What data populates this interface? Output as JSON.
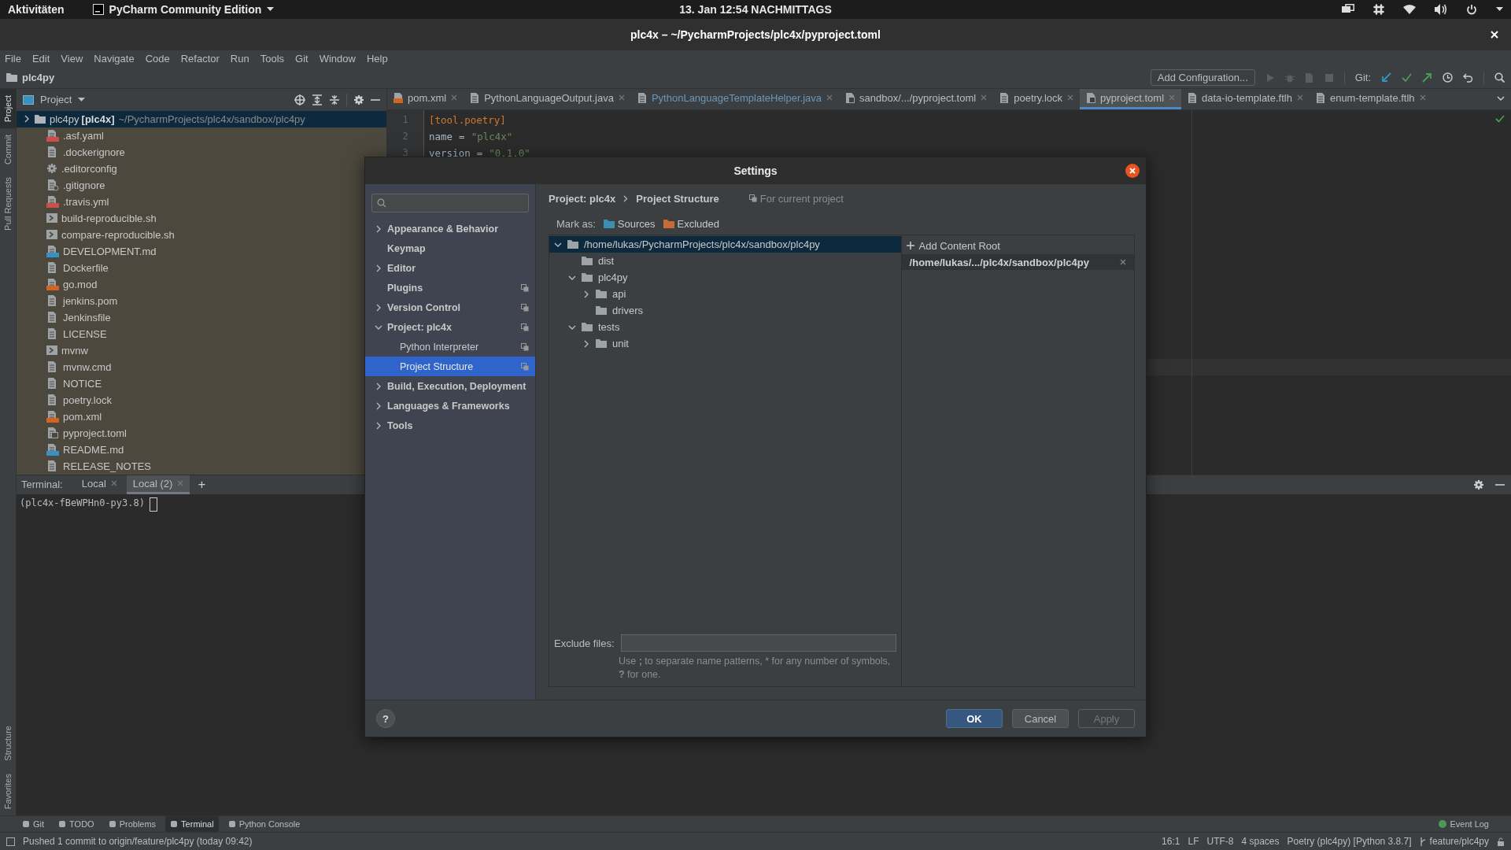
{
  "top_bar": {
    "activities": "Aktivitäten",
    "app": "PyCharm Community Edition",
    "clock": "13. Jan  12:54 NACHMITTAGS"
  },
  "window": {
    "title": "plc4x – ~/PycharmProjects/plc4x/pyproject.toml"
  },
  "menu": [
    "File",
    "Edit",
    "View",
    "Navigate",
    "Code",
    "Refactor",
    "Run",
    "Tools",
    "Git",
    "Window",
    "Help"
  ],
  "breadcrumb": "plc4py",
  "toolbar": {
    "run_config": "Add Configuration...",
    "git_label": "Git:"
  },
  "side_tools": [
    {
      "label": "Project",
      "selected": true
    },
    {
      "label": "Commit",
      "selected": false
    },
    {
      "label": "Pull Requests",
      "selected": false
    }
  ],
  "side_tools_bottom": [
    {
      "label": "Structure",
      "selected": false
    },
    {
      "label": "Favorites",
      "selected": false
    }
  ],
  "project_panel": {
    "title": "Project",
    "root": {
      "name": "plc4py",
      "module": "[plc4x]",
      "path": "~/PycharmProjects/plc4x/sandbox/plc4py",
      "selected": true,
      "expanded": false
    },
    "files": [
      {
        "name": ".asf.yaml",
        "kind": "yaml"
      },
      {
        "name": ".dockerignore",
        "kind": "text"
      },
      {
        "name": ".editorconfig",
        "kind": "config"
      },
      {
        "name": ".gitignore",
        "kind": "ignore"
      },
      {
        "name": ".travis.yml",
        "kind": "yaml"
      },
      {
        "name": "build-reproducible.sh",
        "kind": "shell"
      },
      {
        "name": "compare-reproducible.sh",
        "kind": "shell"
      },
      {
        "name": "DEVELOPMENT.md",
        "kind": "markdown"
      },
      {
        "name": "Dockerfile",
        "kind": "text"
      },
      {
        "name": "go.mod",
        "kind": "dtd"
      },
      {
        "name": "jenkins.pom",
        "kind": "text"
      },
      {
        "name": "Jenkinsfile",
        "kind": "text"
      },
      {
        "name": "LICENSE",
        "kind": "text"
      },
      {
        "name": "mvnw",
        "kind": "shell"
      },
      {
        "name": "mvnw.cmd",
        "kind": "text"
      },
      {
        "name": "NOTICE",
        "kind": "text"
      },
      {
        "name": "poetry.lock",
        "kind": "text"
      },
      {
        "name": "pom.xml",
        "kind": "xml"
      },
      {
        "name": "pyproject.toml",
        "kind": "toml"
      },
      {
        "name": "README.md",
        "kind": "markdown"
      },
      {
        "name": "RELEASE_NOTES",
        "kind": "text"
      }
    ]
  },
  "editor_tabs": [
    {
      "label": "pom.xml",
      "kind": "xml",
      "selected": false,
      "modified": false
    },
    {
      "label": "PythonLanguageOutput.java",
      "kind": "text",
      "selected": false,
      "modified": false
    },
    {
      "label": "PythonLanguageTemplateHelper.java",
      "kind": "text",
      "selected": false,
      "modified": true
    },
    {
      "label": "sandbox/.../pyproject.toml",
      "kind": "toml",
      "selected": false,
      "modified": false
    },
    {
      "label": "poetry.lock",
      "kind": "text",
      "selected": false,
      "modified": false
    },
    {
      "label": "pyproject.toml",
      "kind": "toml",
      "selected": true,
      "modified": false
    },
    {
      "label": "data-io-template.ftlh",
      "kind": "text",
      "selected": false,
      "modified": false
    },
    {
      "label": "enum-template.ftlh",
      "kind": "text",
      "selected": false,
      "modified": false
    }
  ],
  "code_lines": [
    {
      "number": "1",
      "tokens": [
        {
          "text": "[tool.poetry]",
          "kind": "section"
        }
      ]
    },
    {
      "number": "2",
      "tokens": [
        {
          "text": "name",
          "kind": "key"
        },
        {
          "text": "=",
          "kind": "op"
        },
        {
          "text": "\"plc4x\"",
          "kind": "string"
        }
      ]
    },
    {
      "number": "3",
      "tokens": [
        {
          "text": "version",
          "kind": "key"
        },
        {
          "text": "=",
          "kind": "op"
        },
        {
          "text": "\"0.1.0\"",
          "kind": "string"
        }
      ]
    }
  ],
  "terminal": {
    "label": "Terminal:",
    "tabs": [
      {
        "label": "Local",
        "selected": false
      },
      {
        "label": "Local (2)",
        "selected": true
      }
    ],
    "add": "+",
    "prompt": "(plc4x-fBeWPHn0-py3.8)"
  },
  "dialog": {
    "title": "Settings",
    "nav": [
      {
        "label": "Appearance & Behavior",
        "kind": "group",
        "expanded": false,
        "project_scope": false,
        "selected": false
      },
      {
        "label": "Keymap",
        "kind": "page",
        "project_scope": false,
        "selected": false
      },
      {
        "label": "Editor",
        "kind": "group",
        "expanded": false,
        "project_scope": false,
        "selected": false
      },
      {
        "label": "Plugins",
        "kind": "page",
        "project_scope": true,
        "selected": false
      },
      {
        "label": "Version Control",
        "kind": "group",
        "expanded": false,
        "project_scope": true,
        "selected": false
      },
      {
        "label": "Project: plc4x",
        "kind": "group",
        "expanded": true,
        "project_scope": true,
        "selected": false,
        "children": [
          {
            "label": "Python Interpreter",
            "kind": "page",
            "project_scope": true,
            "selected": false
          },
          {
            "label": "Project Structure",
            "kind": "page",
            "project_scope": true,
            "selected": true
          }
        ]
      },
      {
        "label": "Build, Execution, Deployment",
        "kind": "group",
        "expanded": false,
        "project_scope": false,
        "selected": false
      },
      {
        "label": "Languages & Frameworks",
        "kind": "group",
        "expanded": false,
        "project_scope": false,
        "selected": false
      },
      {
        "label": "Tools",
        "kind": "group",
        "expanded": false,
        "project_scope": false,
        "selected": false
      }
    ],
    "breadcrumb": [
      "Project: plc4x",
      "Project Structure"
    ],
    "scope_note": "For current project",
    "mark_as": {
      "label": "Mark as:",
      "buttons": [
        {
          "label": "Sources",
          "color": "#3d8eb3"
        },
        {
          "label": "Excluded",
          "color": "#c86a33"
        }
      ]
    },
    "folders": [
      {
        "name": "/home/lukas/PycharmProjects/plc4x/sandbox/plc4py",
        "kind": "group",
        "selected": true,
        "expanded": true,
        "children": [
          {
            "name": "dist",
            "kind": "leaf",
            "selected": false
          },
          {
            "name": "plc4py",
            "kind": "group",
            "selected": false,
            "expanded": true,
            "children": [
              {
                "name": "api",
                "kind": "group",
                "selected": false,
                "expanded": false
              },
              {
                "name": "drivers",
                "kind": "leaf",
                "selected": false
              }
            ]
          },
          {
            "name": "tests",
            "kind": "group",
            "selected": false,
            "expanded": true,
            "children": [
              {
                "name": "unit",
                "kind": "group",
                "selected": false,
                "expanded": false
              }
            ]
          }
        ]
      }
    ],
    "content_roots": {
      "add": "Add Content Root",
      "roots": [
        "/home/lukas/.../plc4x/sandbox/plc4py"
      ]
    },
    "exclude": {
      "label": "Exclude files:",
      "hint": "Use **;** to separate name patterns, * for any number of symbols, **?** for one."
    },
    "buttons": [
      {
        "label": "OK",
        "kind": "primary",
        "disabled": false
      },
      {
        "label": "Cancel",
        "kind": "normal",
        "disabled": false
      },
      {
        "label": "Apply",
        "kind": "normal",
        "disabled": true
      }
    ],
    "help": "?"
  },
  "bottom_tools": [
    {
      "label": "Git",
      "selected": false
    },
    {
      "label": "TODO",
      "selected": false
    },
    {
      "label": "Problems",
      "selected": false
    },
    {
      "label": "Terminal",
      "selected": true
    },
    {
      "label": "Python Console",
      "selected": false
    }
  ],
  "event_log": "Event Log",
  "status_bar": {
    "message": "Pushed 1 commit to origin/feature/plc4py (today 09:42)",
    "items": [
      "16:1",
      "LF",
      "UTF-8",
      "4 spaces",
      "Poetry (plc4py) [Python 3.8.7]"
    ],
    "branch": "feature/plc4py"
  }
}
